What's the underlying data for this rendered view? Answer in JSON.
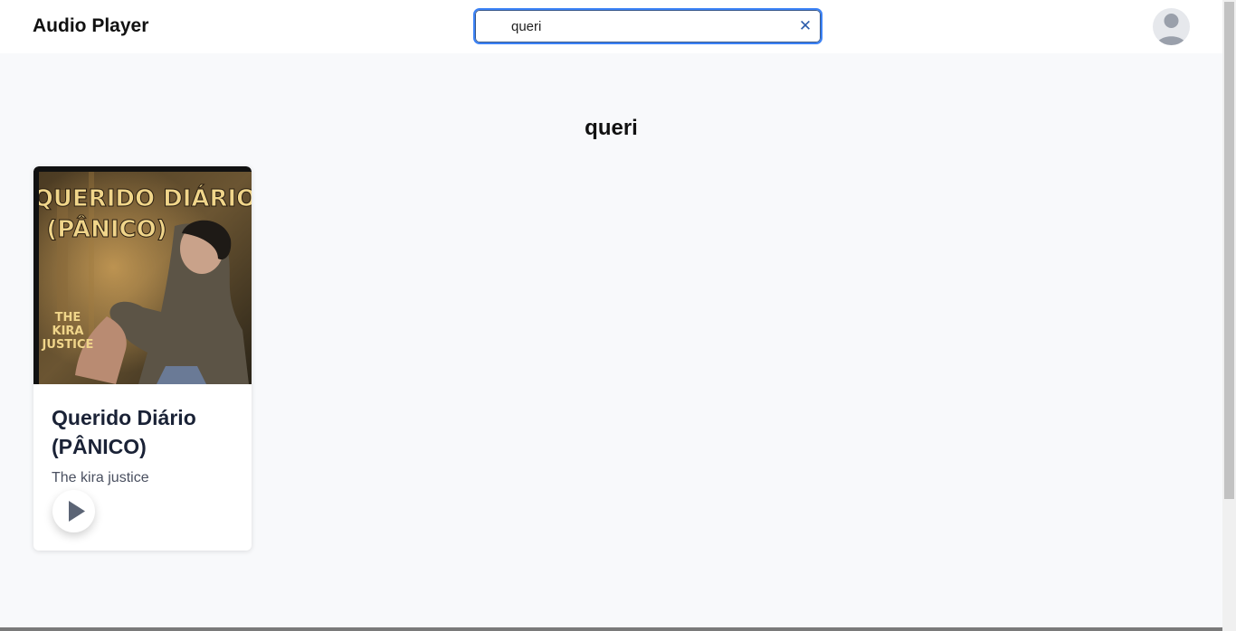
{
  "header": {
    "brand": "Audio Player",
    "search": {
      "value": "queri",
      "clear_icon": "close-icon"
    },
    "avatar_icon": "user-avatar-icon"
  },
  "results": {
    "heading": "queri",
    "items": [
      {
        "title": "Querido Diário (PÂNICO)",
        "artist": "The kira justice",
        "cover_text_line1": "QUERIDO DIÁRIO",
        "cover_text_line2": "(PÂNICO)",
        "cover_text_sub1": "THE",
        "cover_text_sub2": "KIRA",
        "cover_text_sub3": "JUSTICE",
        "play_icon": "play-icon"
      }
    ]
  },
  "colors": {
    "accent": "#3b82f6",
    "clear_icon": "#2b5cab",
    "play_icon": "#5b6475",
    "background": "#f8f9fb"
  }
}
